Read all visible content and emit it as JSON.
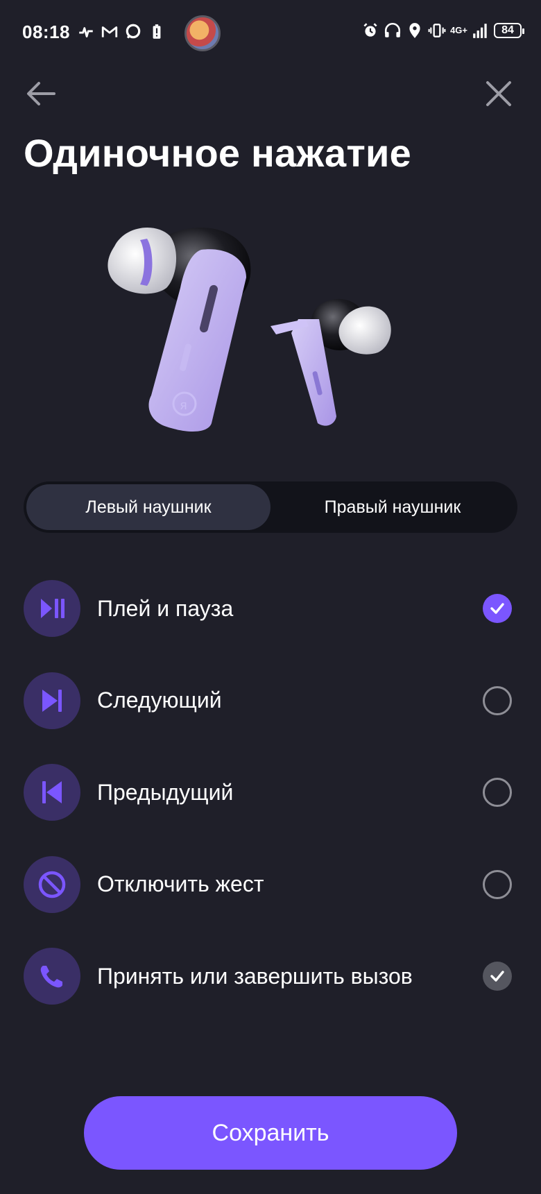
{
  "status_bar": {
    "time": "08:18",
    "network": "4G+",
    "battery": "84",
    "left_icons": [
      "heartbeat-icon",
      "gmail-icon",
      "chat-icon",
      "battery-alert-icon"
    ],
    "right_icons": [
      "alarm-icon",
      "headphones-battery-icon",
      "location-icon",
      "vibrate-icon",
      "signal-icon"
    ]
  },
  "header": {
    "title": "Одиночное нажатие"
  },
  "tabs": [
    {
      "label": "Левый наушник",
      "active": true
    },
    {
      "label": "Правый наушник",
      "active": false
    }
  ],
  "options": [
    {
      "label": "Плей и пауза",
      "icon": "play-pause-icon",
      "state": "selected"
    },
    {
      "label": "Следующий",
      "icon": "next-track-icon",
      "state": "unselected"
    },
    {
      "label": "Предыдущий",
      "icon": "previous-track-icon",
      "state": "unselected"
    },
    {
      "label": "Отключить жест",
      "icon": "disable-icon",
      "state": "unselected"
    },
    {
      "label": "Принять или завершить вызов",
      "icon": "phone-icon",
      "state": "fixed-checked"
    }
  ],
  "save_button": {
    "label": "Сохранить"
  },
  "colors": {
    "background": "#1f1f29",
    "accent": "#7b56ff",
    "icon_bg": "#3a2f66",
    "segment_bg": "#12131a",
    "segment_active": "#2f3141"
  }
}
